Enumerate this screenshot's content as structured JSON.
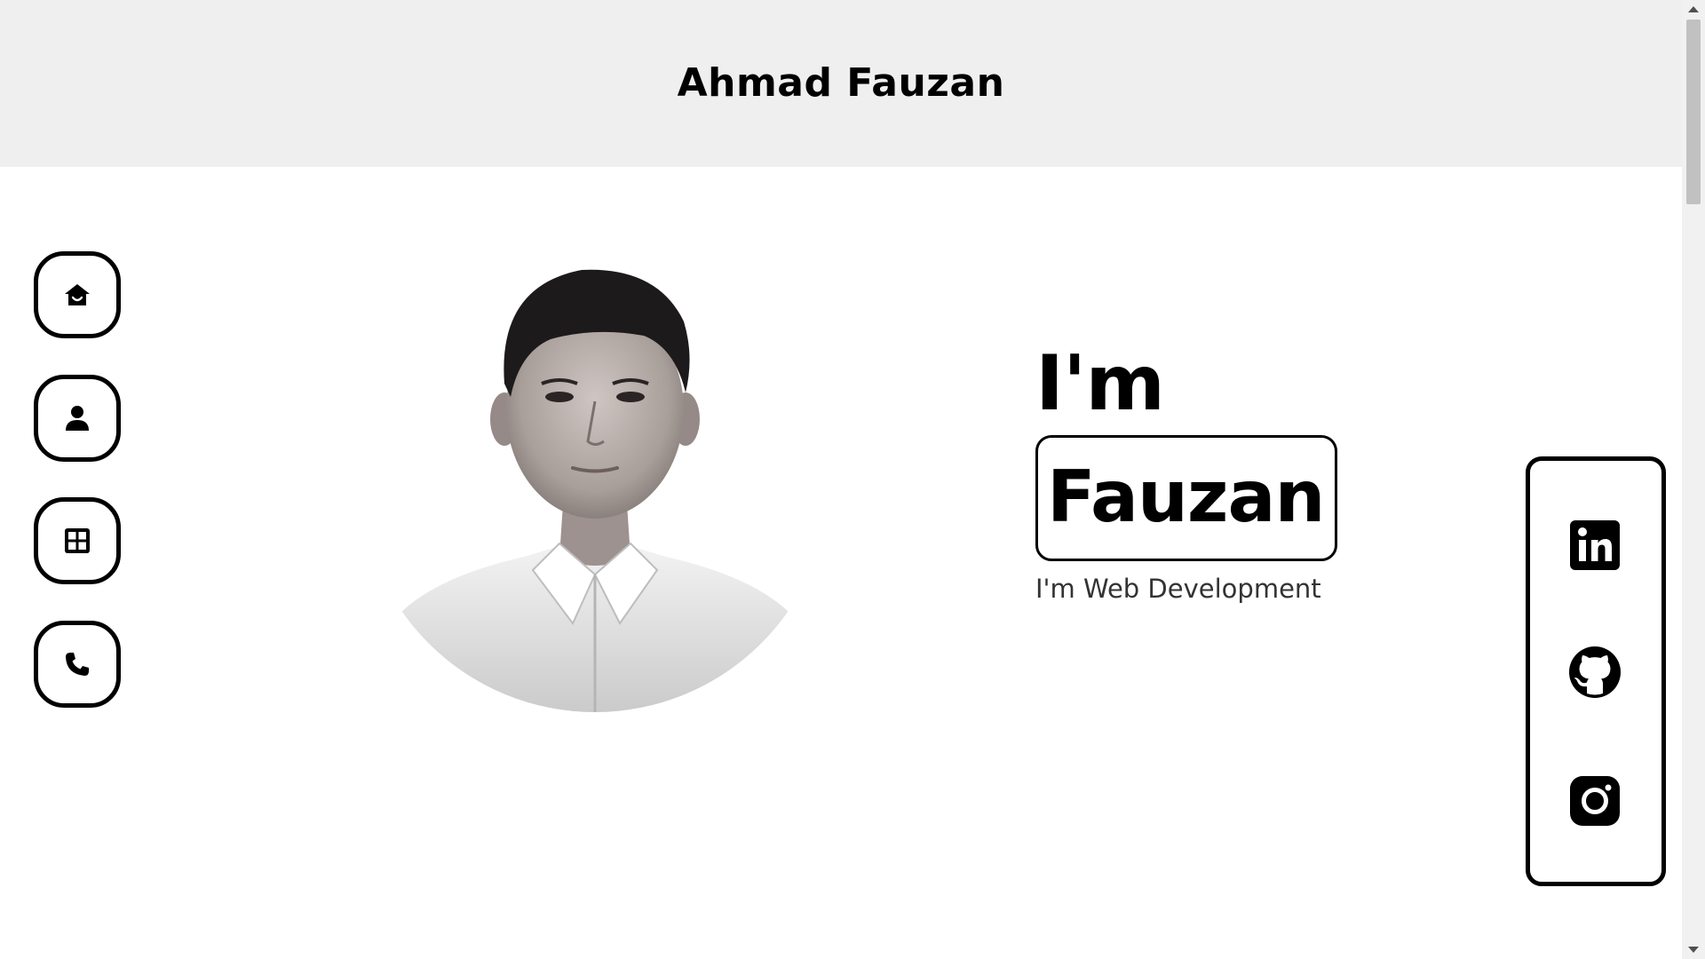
{
  "header": {
    "title": "Ahmad Fauzan"
  },
  "nav": {
    "items": [
      {
        "id": "home",
        "icon": "home-icon"
      },
      {
        "id": "about",
        "icon": "user-icon"
      },
      {
        "id": "portfolio",
        "icon": "grid-icon"
      },
      {
        "id": "contact",
        "icon": "phone-icon"
      }
    ]
  },
  "hero": {
    "greeting": "I'm",
    "name": "Fauzan",
    "role": "I'm Web Development",
    "portrait_icon": "profile-photo"
  },
  "social": {
    "items": [
      {
        "id": "linkedin",
        "icon": "linkedin-icon"
      },
      {
        "id": "github",
        "icon": "github-icon"
      },
      {
        "id": "instagram",
        "icon": "instagram-icon"
      }
    ]
  },
  "colors": {
    "header_bg": "#efefef",
    "page_bg": "#ffffff",
    "accent": "#000000",
    "role_text": "#333333"
  }
}
